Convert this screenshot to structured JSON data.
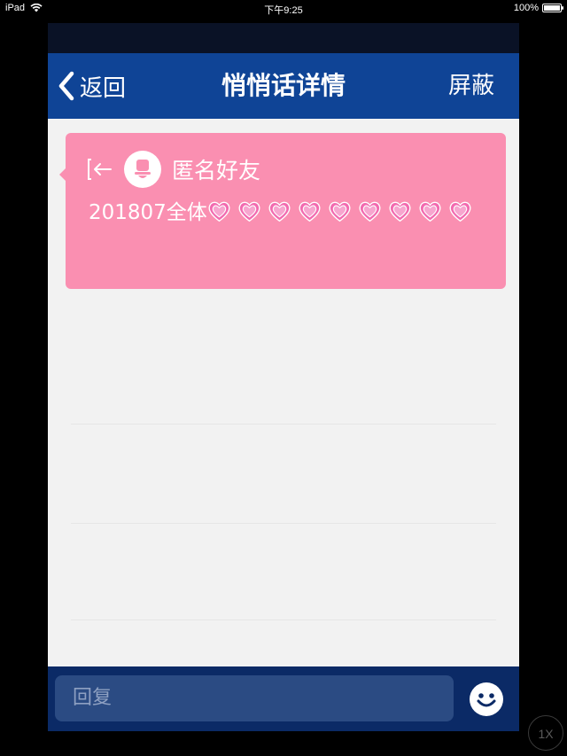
{
  "status_bar": {
    "device": "iPad",
    "time": "下午9:25",
    "battery": "100%",
    "battery_level": 1.0
  },
  "nav": {
    "back_label": "返回",
    "title": "悄悄话详情",
    "block_label": "屏蔽"
  },
  "message": {
    "sender": "匿名好友",
    "text": "201807全体",
    "heart_count": 9,
    "heart_icon": "heart-emoji",
    "card_color": "#fa8fb1"
  },
  "reply": {
    "placeholder": "回复"
  },
  "zoom_badge": "1X"
}
